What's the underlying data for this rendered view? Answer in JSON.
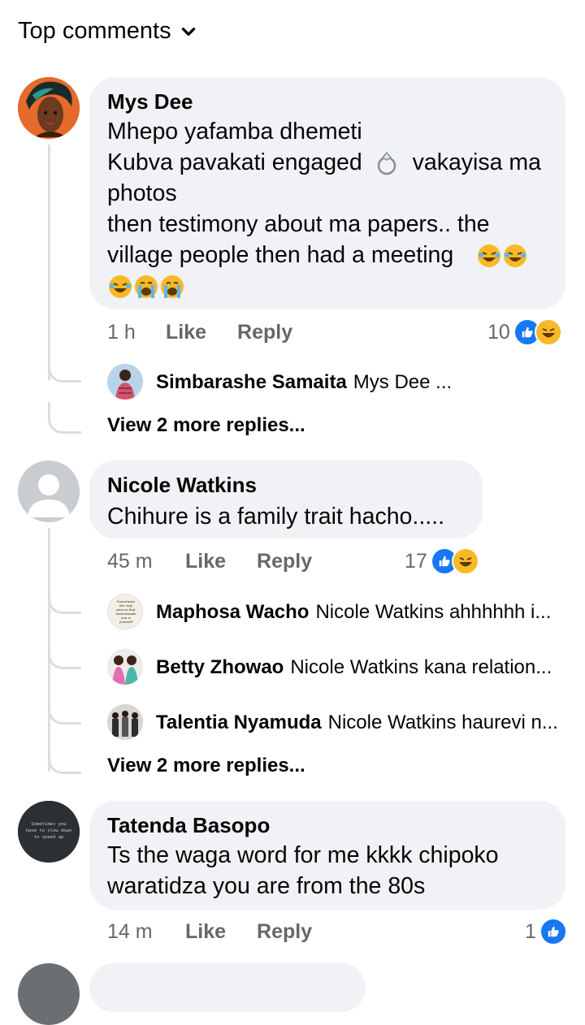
{
  "header": {
    "label": "Top comments"
  },
  "comments": [
    {
      "author": "Mys Dee",
      "lines": [
        "Mhepo yafamba dhemeti",
        "Kubva pavakati engaged",
        "vakayisa ma",
        "photos",
        "then testimony about ma papers.. the",
        "village people then had a meeting"
      ],
      "time": "1 h",
      "like": "Like",
      "reply": "Reply",
      "reactions": "10",
      "replies": [
        {
          "name": "Simbarashe Samaita",
          "text": "Mys Dee ..."
        }
      ],
      "more": "View 2 more replies..."
    },
    {
      "author": "Nicole Watkins",
      "lines": [
        "Chihure is a family trait hacho....."
      ],
      "time": "45 m",
      "like": "Like",
      "reply": "Reply",
      "reactions": "17",
      "replies": [
        {
          "name": "Maphosa Wacho",
          "text": "Nicole Watkins ahhhhhh i..."
        },
        {
          "name": "Betty Zhowao",
          "text": "Nicole Watkins kana relation..."
        },
        {
          "name": "Talentia Nyamuda",
          "text": "Nicole Watkins haurevi n..."
        }
      ],
      "more": "View 2 more replies..."
    },
    {
      "author": "Tatenda Basopo",
      "lines": [
        "Ts the waga word for me kkkk chipoko",
        "waratidza you are from the 80s"
      ],
      "time": "14 m",
      "like": "Like",
      "reply": "Reply",
      "reactions": "1"
    }
  ],
  "avatar_texts": {
    "maphosa": [
      "Sometimes",
      "the only",
      "person that",
      "understands",
      "you is",
      "yourself"
    ],
    "tatenda": [
      "Sometimes you",
      "have to slow down",
      "to speed up"
    ]
  },
  "colors": {
    "like_blue": "#1877f2",
    "haha_yellow": "#f7b928",
    "bubble_bg": "#f0f2f5",
    "meta_gray": "#65676b"
  }
}
